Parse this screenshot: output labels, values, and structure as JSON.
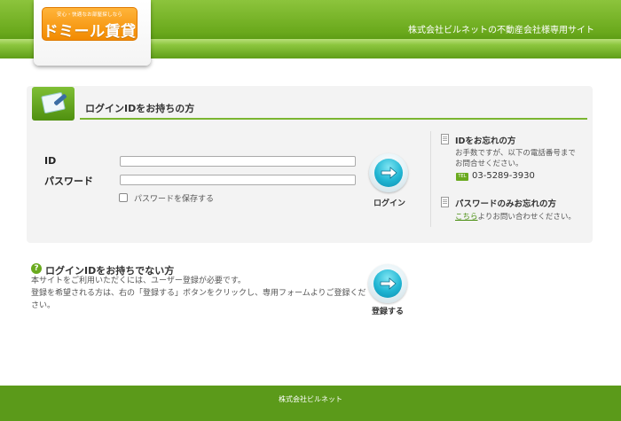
{
  "header": {
    "logo_tagline": "安心・快適なお部屋探しなら",
    "logo_title": "ドミール賃貸",
    "site_caption": "株式会社ビルネットの不動産会社様専用サイト"
  },
  "login": {
    "title": "ログインIDをお持ちの方",
    "id_label": "ID",
    "password_label": "パスワード",
    "id_value": "",
    "password_value": "",
    "save_password_label": "パスワードを保存する",
    "save_password_checked": false,
    "button_label": "ログイン"
  },
  "help": {
    "forgot_id_title": "IDをお忘れの方",
    "forgot_id_text_1": "お手数ですが、以下の電話番号まで",
    "forgot_id_text_2": "お問合せください。",
    "tel_badge": "TEL",
    "tel_number": "03-5289-3930",
    "forgot_pw_title": "パスワードのみお忘れの方",
    "forgot_pw_link": "こちら",
    "forgot_pw_text": "よりお問い合わせください。"
  },
  "register": {
    "title": "ログインIDをお持ちでない方",
    "text_1": "本サイトをご利用いただくには、ユーザー登録が必要です。",
    "text_2": "登録を希望される方は、右の「登録する」ボタンをクリックし、専用フォームよりご登録くだ",
    "text_3": "さい。",
    "button_label": "登録する"
  },
  "footer": {
    "company": "株式会社ビルネット"
  },
  "colors": {
    "brand_green": "#6aa91c",
    "logo_orange": "#f28a00",
    "button_cyan": "#21b6d3"
  }
}
